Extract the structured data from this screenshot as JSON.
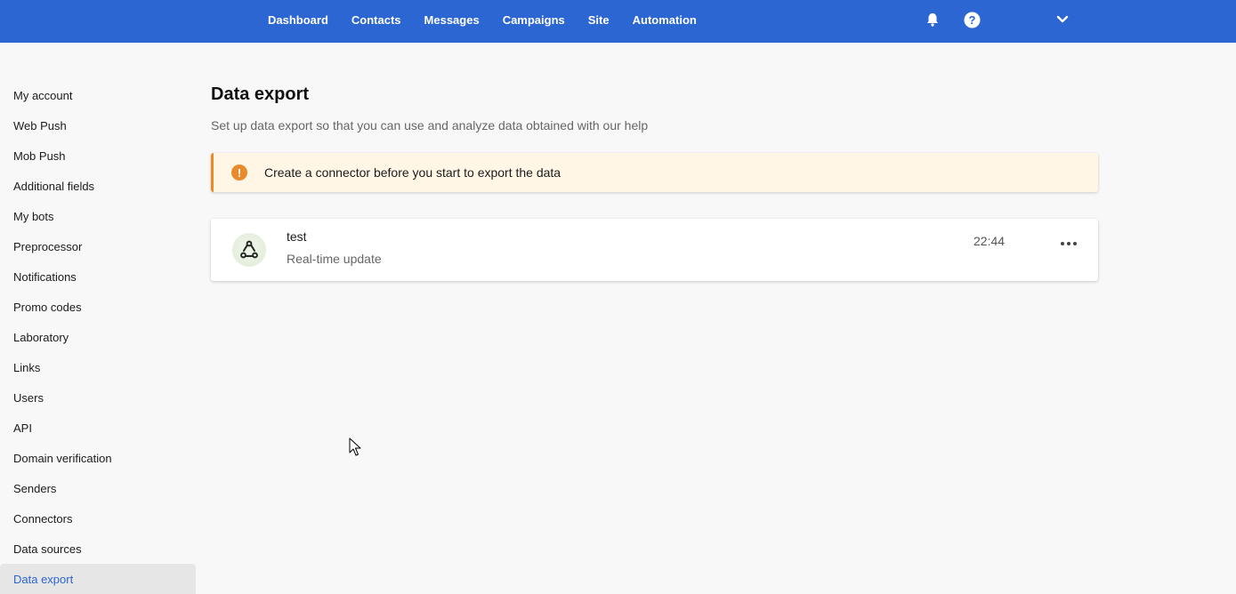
{
  "topnav": {
    "items": [
      "Dashboard",
      "Contacts",
      "Messages",
      "Campaigns",
      "Site",
      "Automation"
    ],
    "icons": {
      "notifications": "bell-icon",
      "help": "help-icon",
      "account": "chevron-down-icon"
    }
  },
  "sidebar": {
    "items": [
      "My account",
      "Web Push",
      "Mob Push",
      "Additional fields",
      "My bots",
      "Preprocessor",
      "Notifications",
      "Promo codes",
      "Laboratory",
      "Links",
      "Users",
      "API",
      "Domain verification",
      "Senders",
      "Connectors",
      "Data sources",
      "Data export"
    ],
    "active": "Data export"
  },
  "page": {
    "title": "Data export",
    "subtitle": "Set up data export so that you can use and analyze data obtained with our help"
  },
  "alert": {
    "icon": "exclamation",
    "text": "Create a connector before you start to export the data"
  },
  "export_item": {
    "name": "test",
    "type": "Real-time update",
    "time": "22:44",
    "icon": "webhook-icon"
  },
  "colors": {
    "header": "#2c66d2",
    "accent": "#2c66d2",
    "warning": "#e98a2c",
    "alert_bg": "#fff6e6"
  }
}
